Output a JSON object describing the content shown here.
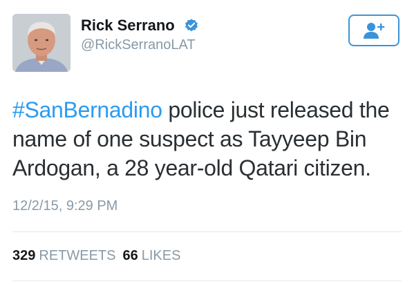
{
  "tweet": {
    "author": {
      "display_name": "Rick Serrano",
      "screen_name": "@RickSerranoLAT",
      "verified": true,
      "avatar_icon": "profile-photo"
    },
    "follow_button": {
      "icon": "add-user-icon",
      "color": "#3b94d9"
    },
    "text": {
      "hashtag": "#SanBernadino",
      "body": " police just released the name of one suspect as Tayyeep Bin Ardogan, a 28 year-old Qatari citizen."
    },
    "timestamp": "12/2/15, 9:29 PM",
    "stats": {
      "retweets_count": "329",
      "retweets_label": "RETWEETS",
      "likes_count": "66",
      "likes_label": "LIKES"
    }
  },
  "colors": {
    "link": "#2b9bf0",
    "muted": "#8899a6",
    "text": "#292f33",
    "verified": "#3b94d9",
    "divider": "#e1e8ed"
  }
}
